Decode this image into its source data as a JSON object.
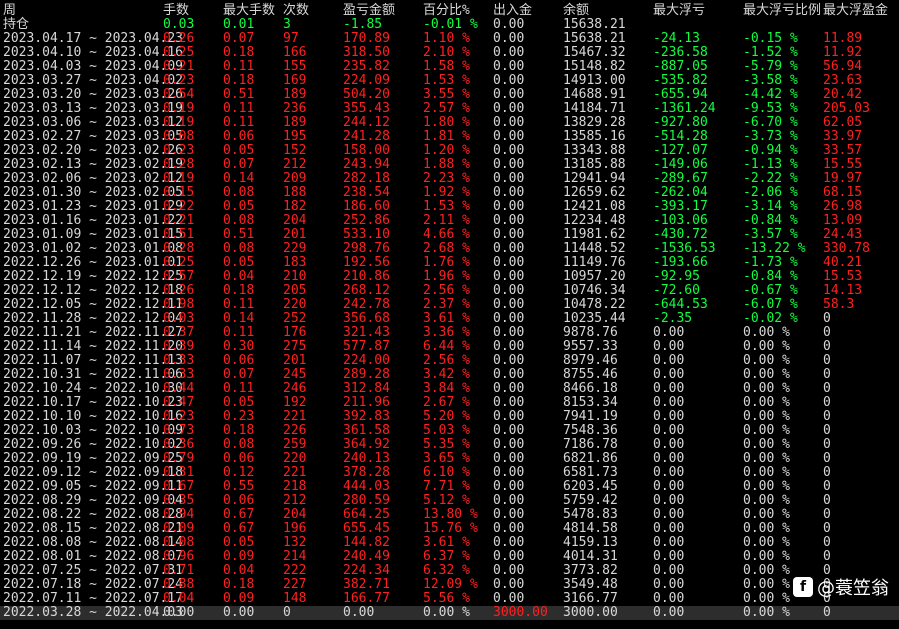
{
  "columns": [
    "周",
    "手数",
    "最大手数",
    "次数",
    "盈亏金额",
    "百分比%",
    "出入金",
    "余额",
    "最大浮亏",
    "最大浮亏比例",
    "最大浮盈金"
  ],
  "holding": {
    "label": "持仓",
    "lots": "0.03",
    "max_lots": "0.01",
    "count": "3",
    "pnl": "-1.85",
    "pct": "-0.01 %",
    "io": "0.00",
    "balance": "15638.21",
    "float_loss": "",
    "float_loss_pct": "",
    "float_gain": ""
  },
  "rows": [
    [
      "2023.04.17 ~ 2023.04.23",
      "0.26",
      "0.07",
      "97",
      "170.89",
      "1.10 %",
      "0.00",
      "15638.21",
      "-24.13",
      "-0.15 %",
      "11.89"
    ],
    [
      "2023.04.10 ~ 2023.04.16",
      "0.25",
      "0.18",
      "166",
      "318.50",
      "2.10 %",
      "0.00",
      "15467.32",
      "-236.58",
      "-1.52 %",
      "11.92"
    ],
    [
      "2023.04.03 ~ 2023.04.09",
      "0.21",
      "0.11",
      "155",
      "235.82",
      "1.58 %",
      "0.00",
      "15148.82",
      "-887.05",
      "-5.79 %",
      "56.94"
    ],
    [
      "2023.03.27 ~ 2023.04.02",
      "0.23",
      "0.18",
      "169",
      "224.09",
      "1.53 %",
      "0.00",
      "14913.00",
      "-535.82",
      "-3.58 %",
      "23.63"
    ],
    [
      "2023.03.20 ~ 2023.03.26",
      "0.54",
      "0.51",
      "189",
      "504.20",
      "3.55 %",
      "0.00",
      "14688.91",
      "-655.94",
      "-4.42 %",
      "20.42"
    ],
    [
      "2023.03.13 ~ 2023.03.19",
      "0.19",
      "0.11",
      "236",
      "355.43",
      "2.57 %",
      "0.00",
      "14184.71",
      "-1361.24",
      "-9.53 %",
      "205.03"
    ],
    [
      "2023.03.06 ~ 2023.03.12",
      "0.19",
      "0.11",
      "189",
      "244.12",
      "1.80 %",
      "0.00",
      "13829.28",
      "-927.80",
      "-6.70 %",
      "62.05"
    ],
    [
      "2023.02.27 ~ 2023.03.05",
      "0.08",
      "0.06",
      "195",
      "241.28",
      "1.81 %",
      "0.00",
      "13585.16",
      "-514.28",
      "-3.73 %",
      "33.97"
    ],
    [
      "2023.02.20 ~ 2023.02.26",
      "0.23",
      "0.05",
      "152",
      "158.00",
      "1.20 %",
      "0.00",
      "13343.88",
      "-127.07",
      "-0.94 %",
      "33.57"
    ],
    [
      "2023.02.13 ~ 2023.02.19",
      "0.28",
      "0.07",
      "212",
      "243.94",
      "1.88 %",
      "0.00",
      "13185.88",
      "-149.06",
      "-1.13 %",
      "15.55"
    ],
    [
      "2023.02.06 ~ 2023.02.12",
      "0.19",
      "0.14",
      "209",
      "282.18",
      "2.23 %",
      "0.00",
      "12941.94",
      "-289.67",
      "-2.22 %",
      "19.97"
    ],
    [
      "2023.01.30 ~ 2023.02.05",
      "0.15",
      "0.08",
      "188",
      "238.54",
      "1.92 %",
      "0.00",
      "12659.62",
      "-262.04",
      "-2.06 %",
      "68.15"
    ],
    [
      "2023.01.23 ~ 2023.01.29",
      "0.22",
      "0.05",
      "182",
      "186.60",
      "1.53 %",
      "0.00",
      "12421.08",
      "-393.17",
      "-3.14 %",
      "26.98"
    ],
    [
      "2023.01.16 ~ 2023.01.22",
      "0.21",
      "0.08",
      "204",
      "252.86",
      "2.11 %",
      "0.00",
      "12234.48",
      "-103.06",
      "-0.84 %",
      "13.09"
    ],
    [
      "2023.01.09 ~ 2023.01.15",
      "0.51",
      "0.51",
      "201",
      "533.10",
      "4.66 %",
      "0.00",
      "11981.62",
      "-430.72",
      "-3.57 %",
      "24.43"
    ],
    [
      "2023.01.02 ~ 2023.01.08",
      "0.28",
      "0.08",
      "229",
      "298.76",
      "2.68 %",
      "0.00",
      "11448.52",
      "-1536.53",
      "-13.22 %",
      "330.78"
    ],
    [
      "2022.12.26 ~ 2023.01.01",
      "0.25",
      "0.05",
      "183",
      "192.56",
      "1.76 %",
      "0.00",
      "11149.76",
      "-193.66",
      "-1.73 %",
      "40.21"
    ],
    [
      "2022.12.19 ~ 2022.12.25",
      "0.57",
      "0.04",
      "210",
      "210.86",
      "1.96 %",
      "0.00",
      "10957.20",
      "-92.95",
      "-0.84 %",
      "15.53"
    ],
    [
      "2022.12.12 ~ 2022.12.18",
      "0.26",
      "0.18",
      "205",
      "268.12",
      "2.56 %",
      "0.00",
      "10746.34",
      "-72.60",
      "-0.67 %",
      "14.13"
    ],
    [
      "2022.12.05 ~ 2022.12.11",
      "0.98",
      "0.11",
      "220",
      "242.78",
      "2.37 %",
      "0.00",
      "10478.22",
      "-644.53",
      "-6.07 %",
      "58.3"
    ],
    [
      "2022.11.28 ~ 2022.12.04",
      "0.03",
      "0.14",
      "252",
      "356.68",
      "3.61 %",
      "0.00",
      "10235.44",
      "-2.35",
      "-0.02 %",
      "0"
    ],
    [
      "2022.11.21 ~ 2022.11.27",
      "0.37",
      "0.11",
      "176",
      "321.43",
      "3.36 %",
      "0.00",
      "9878.76",
      "0.00",
      "0.00 %",
      "0"
    ],
    [
      "2022.11.14 ~ 2022.11.20",
      "0.39",
      "0.30",
      "275",
      "577.87",
      "6.44 %",
      "0.00",
      "9557.33",
      "0.00",
      "0.00 %",
      "0"
    ],
    [
      "2022.11.07 ~ 2022.11.13",
      "0.33",
      "0.06",
      "201",
      "224.00",
      "2.56 %",
      "0.00",
      "8979.46",
      "0.00",
      "0.00 %",
      "0"
    ],
    [
      "2022.10.31 ~ 2022.11.06",
      "0.33",
      "0.07",
      "245",
      "289.28",
      "3.42 %",
      "0.00",
      "8755.46",
      "0.00",
      "0.00 %",
      "0"
    ],
    [
      "2022.10.24 ~ 2022.10.30",
      "0.44",
      "0.11",
      "246",
      "312.84",
      "3.84 %",
      "0.00",
      "8466.18",
      "0.00",
      "0.00 %",
      "0"
    ],
    [
      "2022.10.17 ~ 2022.10.23",
      "0.47",
      "0.05",
      "192",
      "211.96",
      "2.67 %",
      "0.00",
      "8153.34",
      "0.00",
      "0.00 %",
      "0"
    ],
    [
      "2022.10.10 ~ 2022.10.16",
      "0.23",
      "0.23",
      "221",
      "392.83",
      "5.20 %",
      "0.00",
      "7941.19",
      "0.00",
      "0.00 %",
      "0"
    ],
    [
      "2022.10.03 ~ 2022.10.09",
      "0.73",
      "0.18",
      "226",
      "361.58",
      "5.03 %",
      "0.00",
      "7548.36",
      "0.00",
      "0.00 %",
      "0"
    ],
    [
      "2022.09.26 ~ 2022.10.02",
      "0.36",
      "0.08",
      "259",
      "364.92",
      "5.35 %",
      "0.00",
      "7186.78",
      "0.00",
      "0.00 %",
      "0"
    ],
    [
      "2022.09.19 ~ 2022.09.25",
      "0.79",
      "0.06",
      "220",
      "240.13",
      "3.65 %",
      "0.00",
      "6821.86",
      "0.00",
      "0.00 %",
      "0"
    ],
    [
      "2022.09.12 ~ 2022.09.18",
      "0.31",
      "0.12",
      "221",
      "378.28",
      "6.10 %",
      "0.00",
      "6581.73",
      "0.00",
      "0.00 %",
      "0"
    ],
    [
      "2022.09.05 ~ 2022.09.11",
      "0.67",
      "0.55",
      "218",
      "444.03",
      "7.71 %",
      "0.00",
      "6203.45",
      "0.00",
      "0.00 %",
      "0"
    ],
    [
      "2022.08.29 ~ 2022.09.04",
      "0.35",
      "0.06",
      "212",
      "280.59",
      "5.12 %",
      "0.00",
      "5759.42",
      "0.00",
      "0.00 %",
      "0"
    ],
    [
      "2022.08.22 ~ 2022.08.28",
      "0.94",
      "0.67",
      "204",
      "664.25",
      "13.80 %",
      "0.00",
      "5478.83",
      "0.00",
      "0.00 %",
      "0"
    ],
    [
      "2022.08.15 ~ 2022.08.21",
      "0.09",
      "0.67",
      "196",
      "655.45",
      "15.76 %",
      "0.00",
      "4814.58",
      "0.00",
      "0.00 %",
      "0"
    ],
    [
      "2022.08.08 ~ 2022.08.14",
      "0.08",
      "0.05",
      "132",
      "144.82",
      "3.61 %",
      "0.00",
      "4159.13",
      "0.00",
      "0.00 %",
      "0"
    ],
    [
      "2022.08.01 ~ 2022.08.07",
      "0.96",
      "0.09",
      "214",
      "240.49",
      "6.37 %",
      "0.00",
      "4014.31",
      "0.00",
      "0.00 %",
      "0"
    ],
    [
      "2022.07.25 ~ 2022.07.31",
      "0.71",
      "0.04",
      "222",
      "224.34",
      "6.32 %",
      "0.00",
      "3773.82",
      "0.00",
      "0.00 %",
      "0"
    ],
    [
      "2022.07.18 ~ 2022.07.24",
      "0.88",
      "0.18",
      "227",
      "382.71",
      "12.09 %",
      "0.00",
      "3549.48",
      "0.00",
      "0.00 %",
      "0"
    ],
    [
      "2022.07.11 ~ 2022.07.17",
      "0.04",
      "0.09",
      "148",
      "166.77",
      "5.56 %",
      "0.00",
      "3166.77",
      "0.00",
      "0.00 %",
      "0"
    ],
    [
      "2022.03.28 ~ 2022.04.03",
      "0.00",
      "0.00",
      "0",
      "0.00",
      "0.00 %",
      "3000.00",
      "3000.00",
      "0.00",
      "0.00 %",
      "0"
    ]
  ],
  "watermark": {
    "text": "@蓑笠翁",
    "icon": "f"
  },
  "colors": {
    "positive": "#ff2020",
    "negative": "#10ff40",
    "neutral": "#d8d8d8",
    "background": "#000000"
  }
}
